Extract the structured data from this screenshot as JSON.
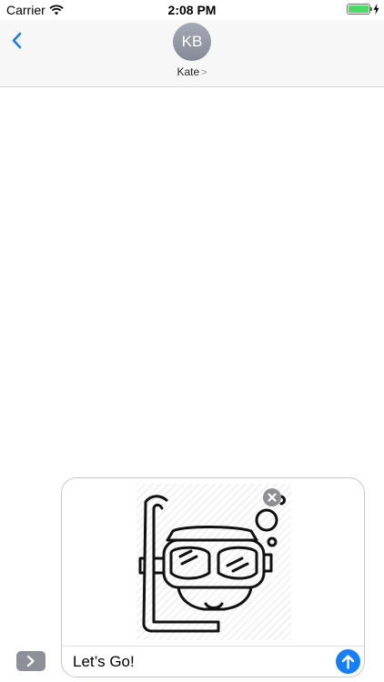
{
  "status_bar": {
    "carrier": "Carrier",
    "time": "2:08 PM",
    "battery_level": 1.0,
    "battery_color": "#4cd964",
    "signal_icon": "wifi-icon",
    "charging_icon": "bolt-icon"
  },
  "header": {
    "back_icon": "chevron-left-icon",
    "avatar_initials": "KB",
    "contact_name": "Kate",
    "contact_chevron": ">"
  },
  "composer": {
    "expand_icon": "chevron-right-icon",
    "sticker_icon": "snorkel-mask-sticker",
    "remove_icon": "close-icon",
    "message_value": "Let’s Go!",
    "send_icon": "arrow-up-icon",
    "accent_color": "#147efb"
  }
}
